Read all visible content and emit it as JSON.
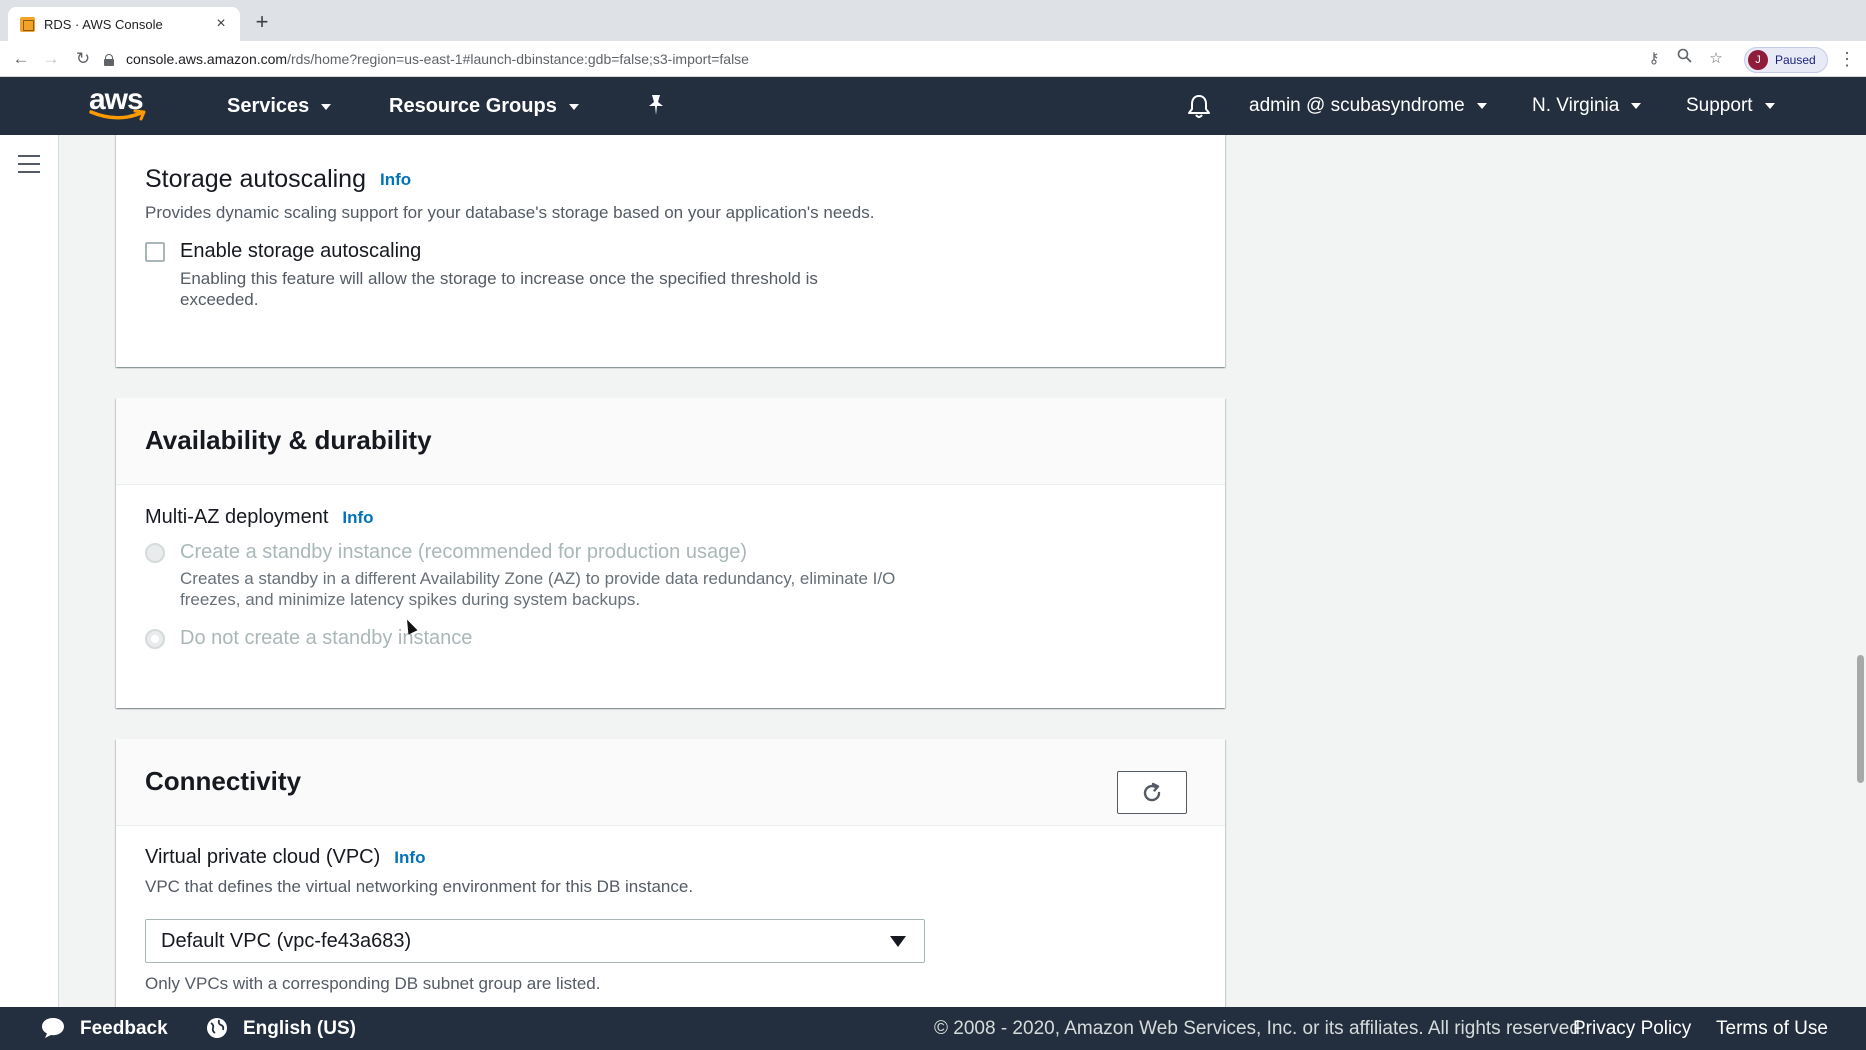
{
  "browser": {
    "tab_title": "RDS · AWS Console",
    "tab_close": "×",
    "new_tab": "+",
    "url_host": "console.aws.amazon.com",
    "url_path": "/rds/home?region=us-east-1#launch-dbinstance:gdb=false;s3-import=false",
    "profile_initial": "J",
    "profile_status": "Paused"
  },
  "nav": {
    "logo": "aws",
    "services": "Services",
    "resource_groups": "Resource Groups",
    "account": "admin @ scubasyndrome",
    "region": "N. Virginia",
    "support": "Support"
  },
  "storage_autoscaling": {
    "heading": "Storage autoscaling",
    "info": "Info",
    "description": "Provides dynamic scaling support for your database's storage based on your application's needs.",
    "checkbox_label": "Enable storage autoscaling",
    "checkbox_desc": "Enabling this feature will allow the storage to increase once the specified threshold is exceeded."
  },
  "availability": {
    "title": "Availability & durability",
    "multi_az_label": "Multi-AZ deployment",
    "info": "Info",
    "option1_label": "Create a standby instance (recommended for production usage)",
    "option1_desc": "Creates a standby in a different Availability Zone (AZ) to provide data redundancy, eliminate I/O freezes, and minimize latency spikes during system backups.",
    "option2_label": "Do not create a standby instance"
  },
  "connectivity": {
    "title": "Connectivity",
    "vpc_label": "Virtual private cloud (VPC)",
    "info": "Info",
    "vpc_desc": "VPC that defines the virtual networking environment for this DB instance.",
    "vpc_selected": "Default VPC (vpc-fe43a683)",
    "vpc_hint": "Only VPCs with a corresponding DB subnet group are listed."
  },
  "footer": {
    "feedback": "Feedback",
    "language": "English (US)",
    "copyright": "© 2008 - 2020, Amazon Web Services, Inc. or its affiliates. All rights reserved.",
    "privacy": "Privacy Policy",
    "terms": "Terms of Use"
  },
  "colors": {
    "nav_bg": "#232f3e",
    "info_link": "#0073bb",
    "aws_orange": "#ff9900"
  }
}
